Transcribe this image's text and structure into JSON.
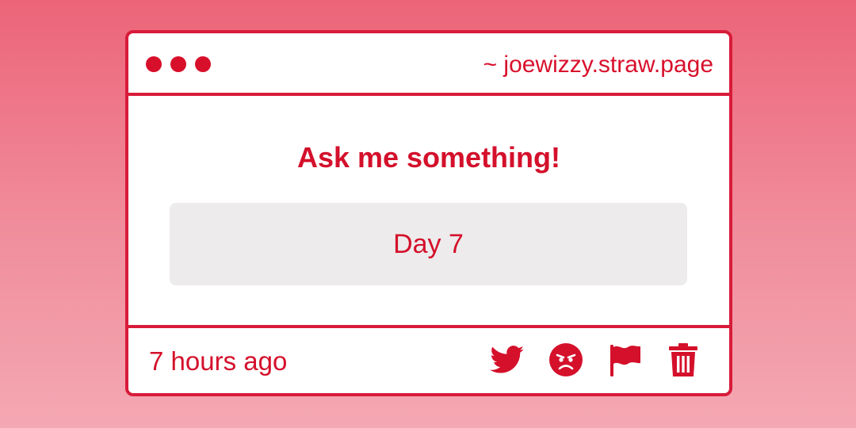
{
  "window": {
    "url_text": "~ joewizzy.straw.page"
  },
  "card": {
    "heading": "Ask me something!",
    "question": "Day 7"
  },
  "footer": {
    "timestamp": "7 hours ago",
    "actions": [
      {
        "icon": "twitter-icon"
      },
      {
        "icon": "angry-face-icon"
      },
      {
        "icon": "flag-icon"
      },
      {
        "icon": "trash-icon"
      }
    ]
  },
  "colors": {
    "accent": "#d81b3a",
    "question_bg": "#edebec",
    "background_top": "#ec6478",
    "background_bottom": "#f4a8b3"
  }
}
